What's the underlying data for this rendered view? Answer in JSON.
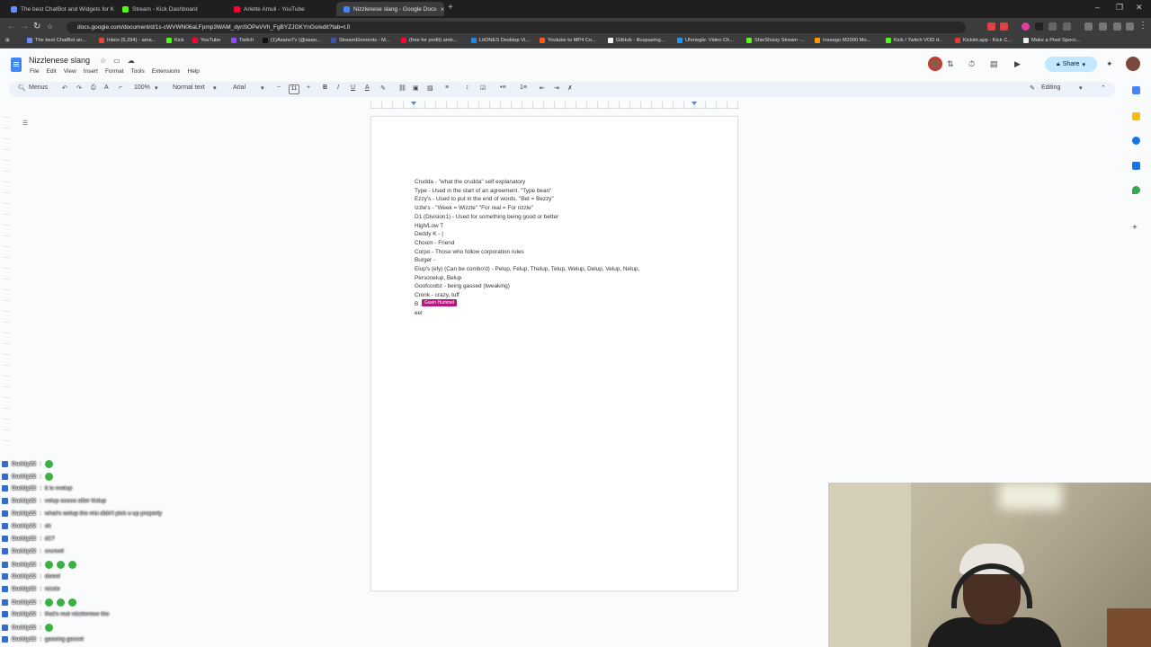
{
  "browser": {
    "tabs": [
      {
        "title": "The best ChatBot and Widgets for K",
        "color": "#6b8cff",
        "active": false
      },
      {
        "title": "Stream - Kick Dashboard",
        "color": "#53fc18",
        "active": false
      },
      {
        "title": "Arlette Amuli - YouTube",
        "color": "#ff0033",
        "active": false
      },
      {
        "title": "Nizzlenese slang - Google Docs",
        "color": "#4285f4",
        "active": true
      }
    ],
    "new_tab_glyph": "+",
    "url": "docs.google.com/document/d/1s-cWVWN06aLFpmp3WAM_dynSOPeVVh_FgBYZJGKYnGo/edit?tab=t.0",
    "bookmarks": [
      {
        "label": "The best ChatBot an...",
        "color": "#6b8cff"
      },
      {
        "label": "Inbox (5,294) - ama...",
        "color": "#ea4335"
      },
      {
        "label": "Kick",
        "color": "#53fc18"
      },
      {
        "label": "YouTube",
        "color": "#ff0033"
      },
      {
        "label": "Twitch",
        "color": "#9146ff"
      },
      {
        "label": "(1)AsanoTv (@asan...",
        "color": "#111111"
      },
      {
        "label": "StreamElements - M...",
        "color": "#3f51b5"
      },
      {
        "label": "(free for profit) amb...",
        "color": "#ff0033"
      },
      {
        "label": "LitONES Desktop Vi...",
        "color": "#1e88e5"
      },
      {
        "label": "Youtube to MP4 Co...",
        "color": "#ff5722"
      },
      {
        "label": "GitHub - illuspas/ng...",
        "color": "#f5f5f5"
      },
      {
        "label": "Uhmegle: Video Ch...",
        "color": "#2196f3"
      },
      {
        "label": "ShieShizzy Stream -...",
        "color": "#53fc18"
      },
      {
        "label": "Inseego M2000 Mo...",
        "color": "#ff9800"
      },
      {
        "label": "Kick / Twitch VOD d...",
        "color": "#53fc18"
      },
      {
        "label": "Kicklet.app - Kick C...",
        "color": "#e53935"
      },
      {
        "label": "Make a Pixel Specc...",
        "color": "#eeeeee"
      }
    ]
  },
  "docs": {
    "title": "Nizzlenese slang",
    "menus": [
      "File",
      "Edit",
      "View",
      "Insert",
      "Format",
      "Tools",
      "Extensions",
      "Help"
    ],
    "share_label": "Share",
    "toolbar": {
      "menus_label": "Menus",
      "zoom": "100%",
      "style": "Normal text",
      "font": "Arial",
      "font_size": "11",
      "mode": "Editing"
    },
    "lines": [
      "Crudda - \"what the crudda\" self explanatory",
      "Type - Used in the start of an agreement. \"Type bean\"",
      "Ezzy's - Used to put in the end of words. \"Bet = Bezzy\"",
      "Izzle's - \"Week = Wizzle\" \"For real = For rizzle\"",
      "D1 (Division1) - Used for something being good or better",
      "High/Low T",
      "Deddy K - |",
      "Choom - Friend",
      "Corpo - Those who follow corporation rules",
      "Burger -",
      "Elup's (ely) (Can be combo'd) - Pelup, Felup, Thelup, Telup, Welup, Delup, Velup, Nelup,",
      "Personelup, Belup",
      "Goofcoobz - being gassed (tweaking)",
      "Cronk - crazy, tuff",
      "B               , Crudda, Type",
      "eel"
    ],
    "collaborator_flag": "Gavin Hummel"
  },
  "chat": {
    "messages": [
      {
        "user": "Daddy22",
        "text": "",
        "emotes": 1
      },
      {
        "user": "Daddy22",
        "text": "",
        "emotes": 1
      },
      {
        "user": "Daddy22",
        "text": "it is vvelup",
        "emotes": 0
      },
      {
        "user": "Daddy22",
        "text": "velup soooo after thdup",
        "emotes": 0
      },
      {
        "user": "Daddy22",
        "text": "what's welup the mix didn't pick u up properly",
        "emotes": 0
      },
      {
        "user": "Daddy22",
        "text": "ok",
        "emotes": 0
      },
      {
        "user": "Daddy22",
        "text": "d1?",
        "emotes": 0
      },
      {
        "user": "Daddy22",
        "text": "crunvel",
        "emotes": 0
      },
      {
        "user": "Daddy22",
        "text": "",
        "emotes": 3
      },
      {
        "user": "Daddy22",
        "text": "dweel",
        "emotes": 0
      },
      {
        "user": "Daddy22",
        "text": "nizzle",
        "emotes": 0
      },
      {
        "user": "Daddy22",
        "text": "",
        "emotes": 3
      },
      {
        "user": "Daddy22",
        "text": "that's real nizzlenese tho",
        "emotes": 0
      },
      {
        "user": "Daddy22",
        "text": "",
        "emotes": 1
      },
      {
        "user": "Daddy22",
        "text": "gassing gezzel",
        "emotes": 0
      }
    ]
  },
  "colors": {
    "accent": "#4285f4",
    "share_bg": "#c2e7ff",
    "collab_flag": "#b3197f"
  }
}
